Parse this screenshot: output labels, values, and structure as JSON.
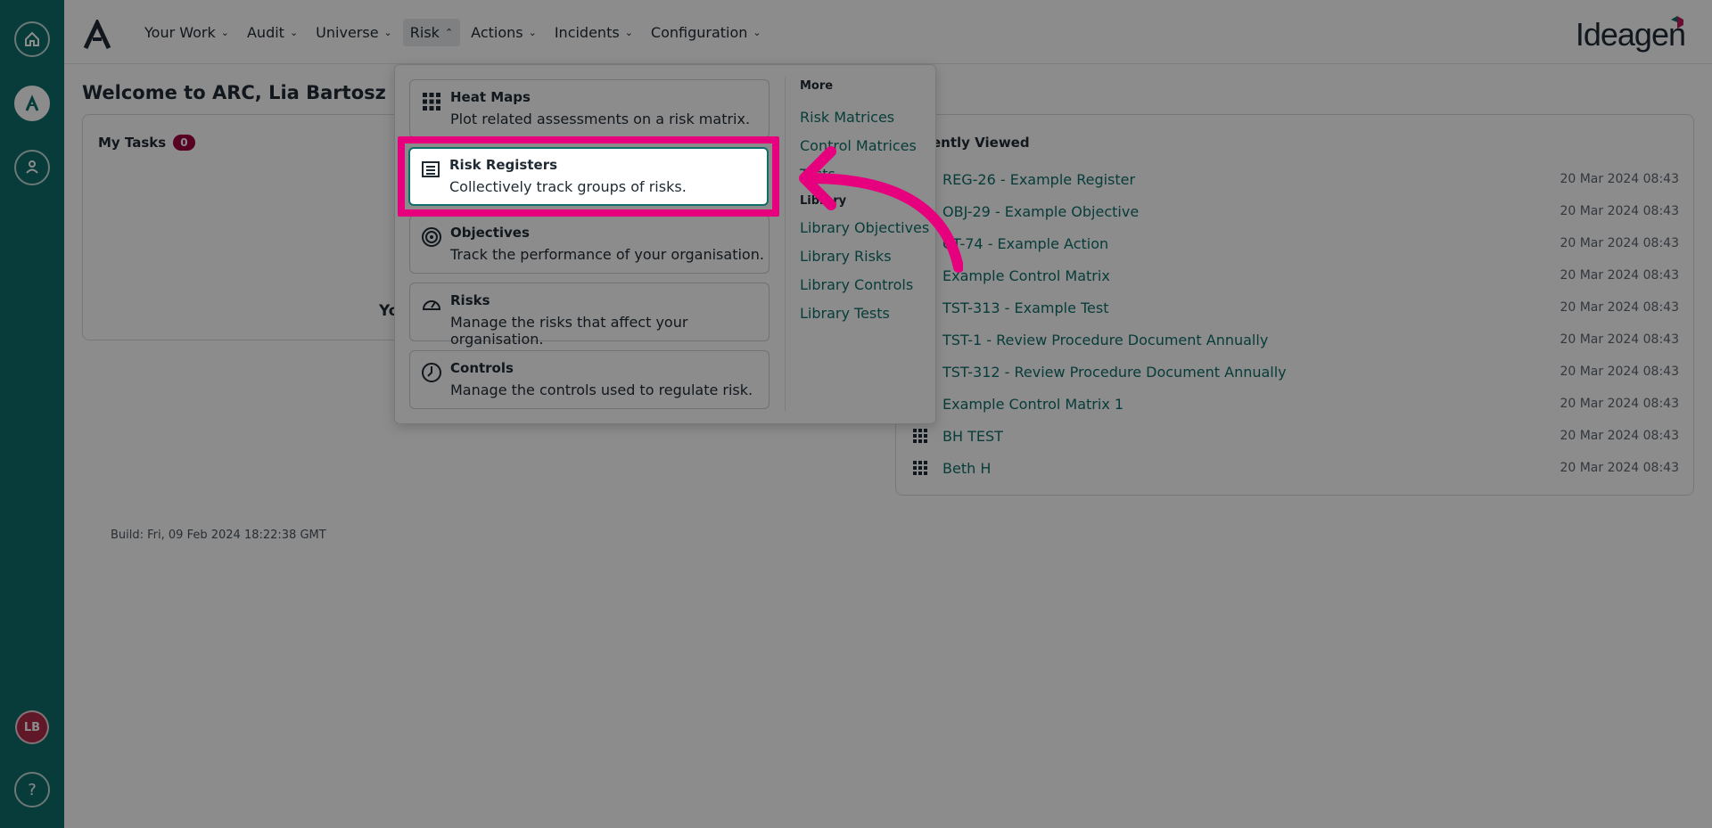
{
  "nav": {
    "items": [
      {
        "label": "Your Work"
      },
      {
        "label": "Audit"
      },
      {
        "label": "Universe"
      },
      {
        "label": "Risk"
      },
      {
        "label": "Actions"
      },
      {
        "label": "Incidents"
      },
      {
        "label": "Configuration"
      }
    ],
    "brand": "Ideagen"
  },
  "rail": {
    "avatar_initials": "LB"
  },
  "page": {
    "welcome": "Welcome to ARC, Lia Bartosz",
    "build": "Build: Fri, 09 Feb 2024 18:22:38 GMT"
  },
  "tasks": {
    "title": "My Tasks",
    "count": "0",
    "empty_text_partial": "Yo"
  },
  "recent": {
    "title": "ently Viewed",
    "items": [
      {
        "name": "REG-26 - Example Register",
        "when": "20 Mar 2024 08:43"
      },
      {
        "name": "OBJ-29 - Example Objective",
        "when": "20 Mar 2024 08:43"
      },
      {
        "name": "CT-74 - Example Action",
        "when": "20 Mar 2024 08:43"
      },
      {
        "name": "Example Control Matrix",
        "when": "20 Mar 2024 08:43"
      },
      {
        "name": "TST-313 - Example Test",
        "when": "20 Mar 2024 08:43"
      },
      {
        "name": "TST-1 - Review Procedure Document Annually",
        "when": "20 Mar 2024 08:43"
      },
      {
        "name": "TST-312 - Review Procedure Document Annually",
        "when": "20 Mar 2024 08:43"
      },
      {
        "name": "Example Control Matrix 1",
        "when": "20 Mar 2024 08:43"
      },
      {
        "name": "BH TEST",
        "when": "20 Mar 2024 08:43"
      },
      {
        "name": "Beth H",
        "when": "20 Mar 2024 08:43"
      }
    ]
  },
  "dropdown": {
    "items": [
      {
        "title": "Heat Maps",
        "desc": "Plot related assessments on a risk matrix."
      },
      {
        "title": "Risk Registers",
        "desc": "Collectively track groups of risks."
      },
      {
        "title": "Objectives",
        "desc": "Track the performance of your organisation."
      },
      {
        "title": "Risks",
        "desc": "Manage the risks that affect your organisation."
      },
      {
        "title": "Controls",
        "desc": "Manage the controls used to regulate risk."
      }
    ],
    "more_heading": "More",
    "more_links": [
      "Risk Matrices",
      "Control Matrices",
      "Tests"
    ],
    "library_heading": "Library",
    "library_links": [
      "Library Objectives",
      "Library Risks",
      "Library Controls",
      "Library Tests"
    ]
  },
  "colors": {
    "teal": "#0e6e6a",
    "highlight": "#e6007e",
    "badge": "#a0003c"
  }
}
